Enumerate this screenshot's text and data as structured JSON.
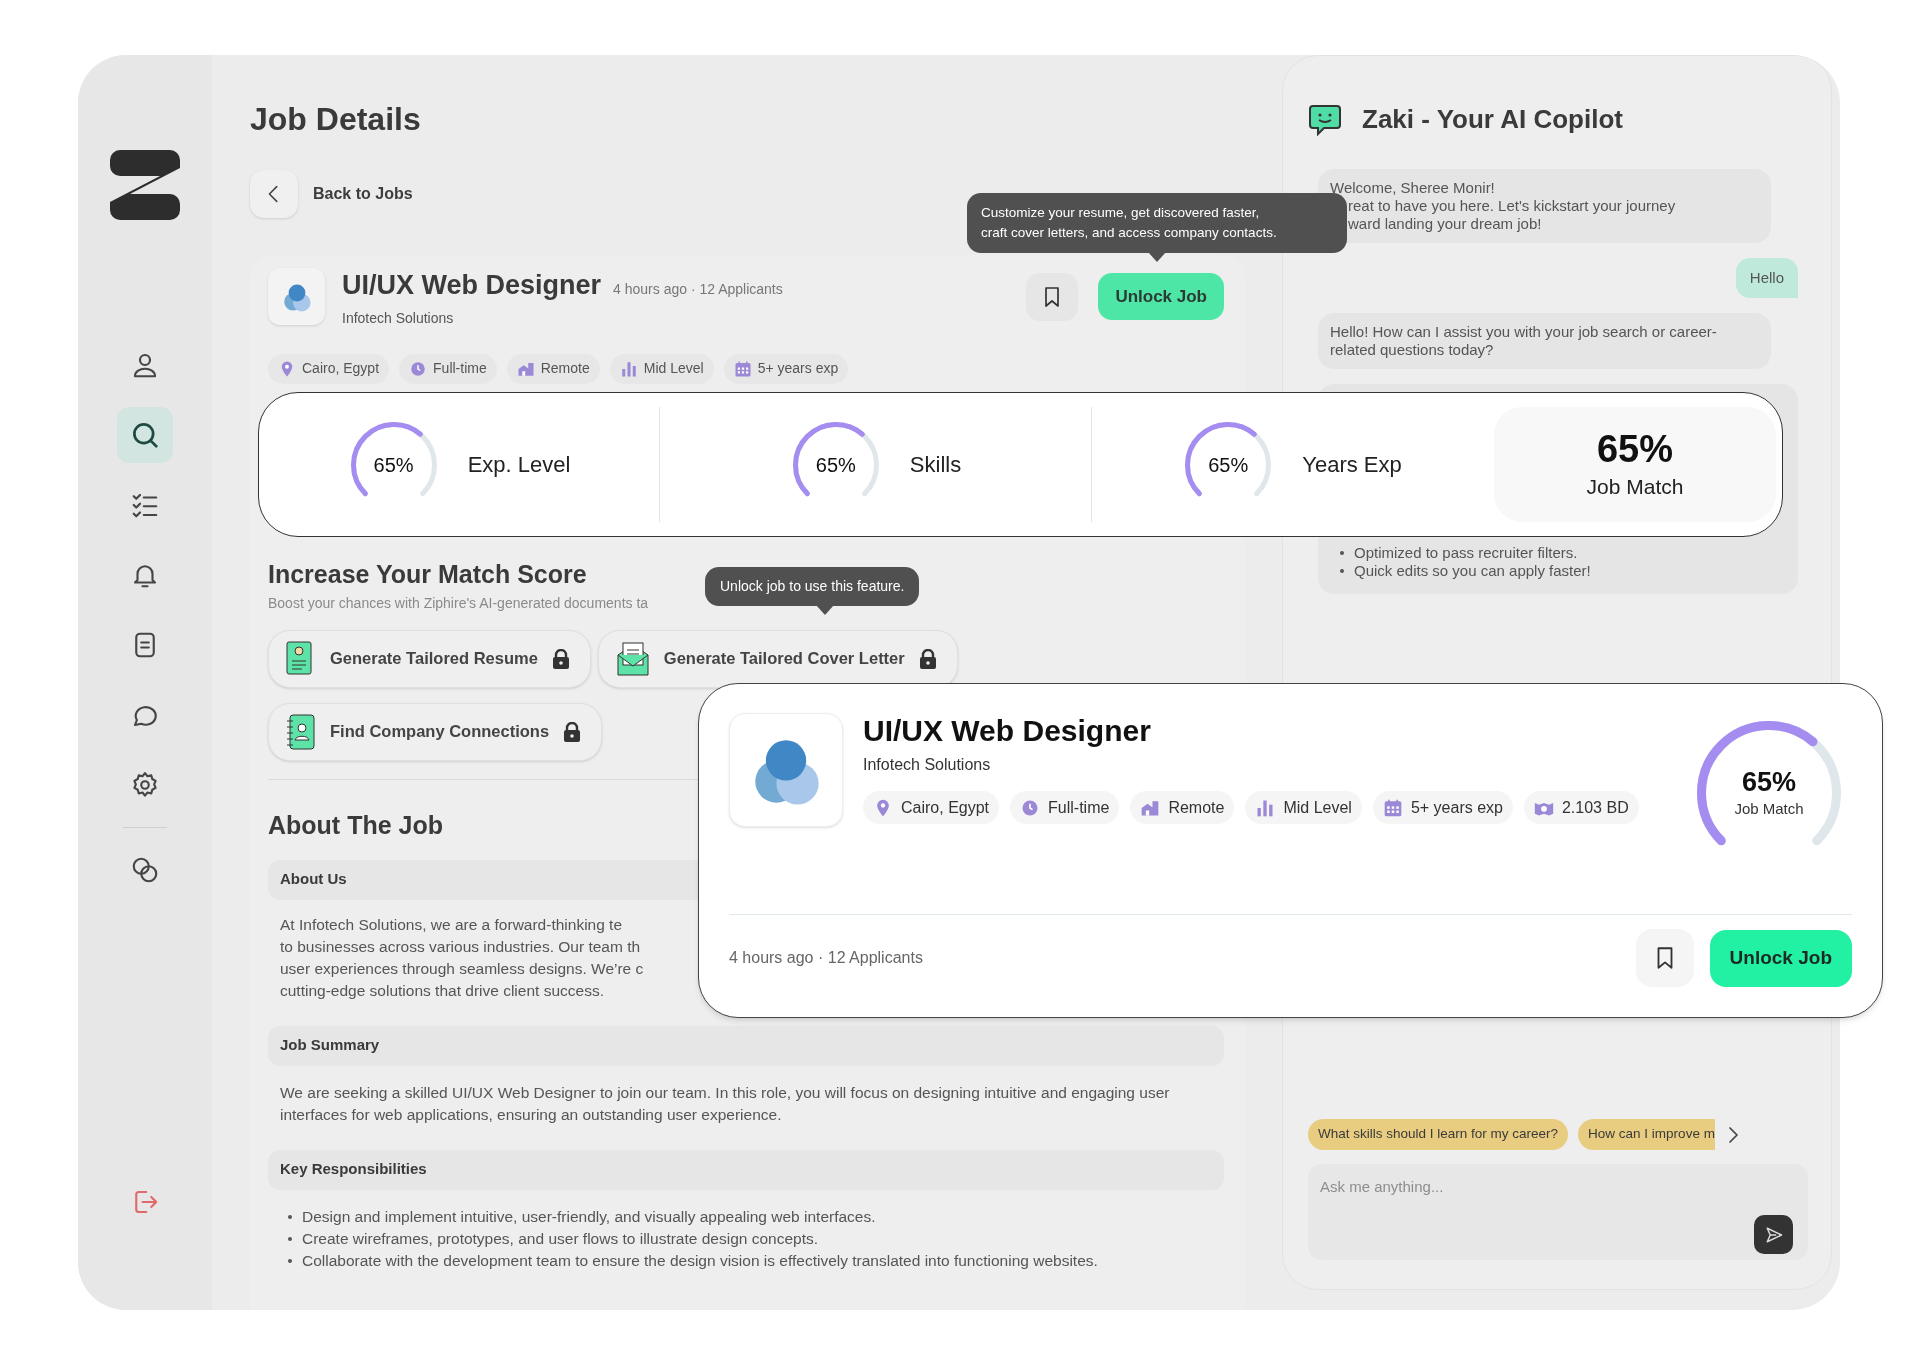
{
  "sidebar": {
    "items": [
      {
        "selected": false
      },
      {
        "selected": true
      },
      {
        "selected": false
      },
      {
        "selected": false
      },
      {
        "selected": false
      },
      {
        "selected": false
      },
      {
        "selected": false
      },
      {
        "selected": false
      }
    ]
  },
  "page": {
    "title": "Job Details",
    "back": "Back to Jobs"
  },
  "job": {
    "title": "UI/UX Web Designer",
    "meta": "4 hours ago · 12 Applicants",
    "company": "Infotech Solutions",
    "unlock": "Unlock Job",
    "tags": [
      "Cairo, Egypt",
      "Full-time",
      "Remote",
      "Mid Level",
      "5+ years exp"
    ]
  },
  "unlock_tooltip": {
    "lines": [
      "Customize your resume, get discovered faster,",
      "craft cover letters, and access company contacts."
    ]
  },
  "match_strip": {
    "gauges": [
      {
        "value": "65%",
        "label": "Exp. Level",
        "level": 0.65
      },
      {
        "value": "65%",
        "label": "Skills",
        "level": 0.65
      },
      {
        "value": "65%",
        "label": "Years Exp",
        "level": 0.65
      }
    ],
    "total": {
      "value": "65%",
      "label": "Job Match"
    }
  },
  "boost": {
    "title": "Increase Your Match Score",
    "subtitle": "Boost your chances with Ziphire's AI-generated documents ta",
    "tooltip": "Unlock job to use this feature.",
    "actions": [
      {
        "label": "Generate Tailored Resume",
        "locked": true
      },
      {
        "label": "Generate Tailored Cover Letter",
        "locked": true
      },
      {
        "label": "Find Company Connections",
        "locked": true
      }
    ]
  },
  "about": {
    "title": "About The Job",
    "sections": [
      {
        "heading": "About Us",
        "kind": "lines",
        "lines": [
          "At Infotech Solutions, we are a forward-thinking te",
          "to businesses across various industries. Our team th",
          "user experiences through seamless designs. We’re c",
          "cutting-edge solutions that drive client success."
        ]
      },
      {
        "heading": "Job Summary",
        "kind": "paragraph",
        "text": "We are seeking a skilled UI/UX Web Designer to join our team. In this role, you will focus on designing intuitive and engaging user interfaces for web applications, ensuring an outstanding user experience."
      },
      {
        "heading": "Key Responsibilities",
        "kind": "bullets",
        "items": [
          "Design and implement intuitive, user-friendly, and visually appealing web interfaces.",
          "Create wireframes, prototypes, and user flows to illustrate design concepts.",
          "Collaborate with the development team to ensure the design vision is effectively translated into functioning websites."
        ]
      }
    ]
  },
  "card": {
    "title": "UI/UX Web Designer",
    "company": "Infotech Solutions",
    "tags": [
      "Cairo, Egypt",
      "Full-time",
      "Remote",
      "Mid Level",
      "5+ years exp",
      "2.103 BD"
    ],
    "meta": "4 hours ago · 12 Applicants",
    "unlock": "Unlock Job",
    "gauge": {
      "value": "65%",
      "label": "Job Match",
      "level": 0.65
    }
  },
  "copilot": {
    "title": "Zaki - Your AI Copilot",
    "messages": [
      {
        "kind": "bot_lines",
        "lines": [
          "Welcome, Sheree Monir!",
          "reat to have you here. Let's kickstart your journey",
          "ward landing your dream job!"
        ]
      },
      {
        "kind": "user_text",
        "text": "Hello"
      },
      {
        "kind": "bot_text",
        "text": "Hello! How can I assist you with your job search or career-related questions today?"
      },
      {
        "kind": "bot_bullets",
        "items": [
          "Optimized to pass recruiter filters.",
          "Quick edits so you can apply faster!"
        ]
      }
    ],
    "suggestions": [
      "What skills should I learn for my career?",
      "How can I improve m"
    ],
    "input": {
      "placeholder": "Ask me anything..."
    }
  }
}
